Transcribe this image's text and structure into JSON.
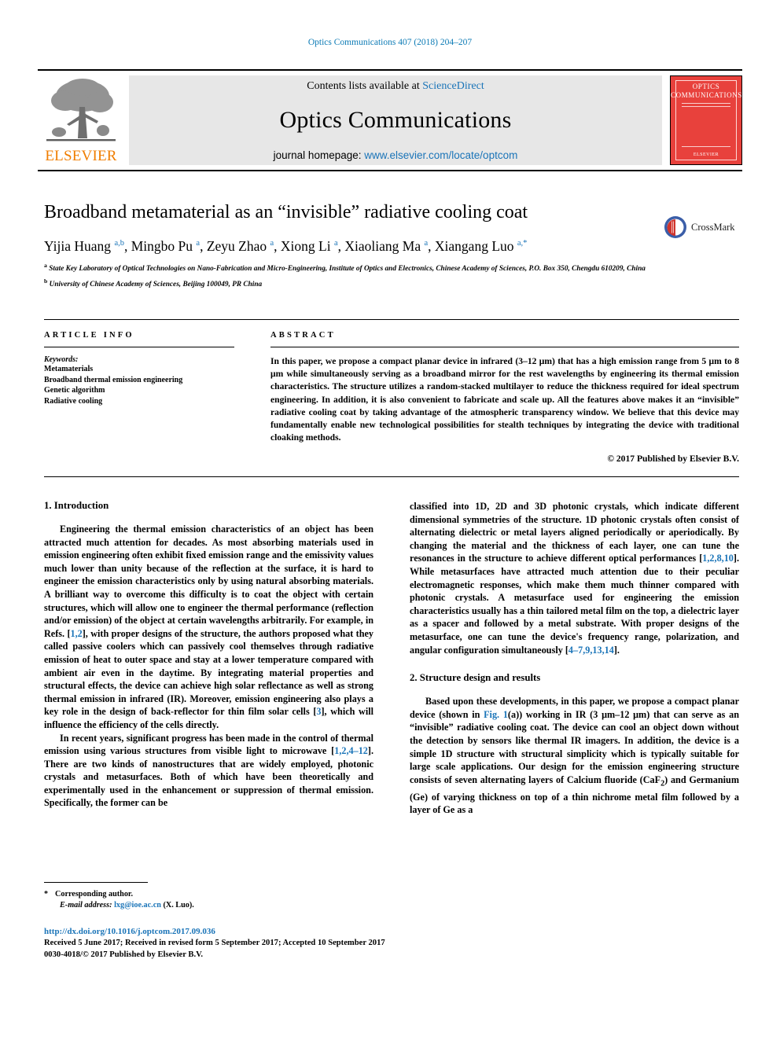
{
  "running_head": "Optics Communications 407 (2018) 204–207",
  "masthead": {
    "contents_prefix": "Contents lists available at ",
    "contents_link": "ScienceDirect",
    "journal_title": "Optics Communications",
    "homepage_prefix": "journal homepage: ",
    "homepage_link": "www.elsevier.com/locate/optcom",
    "publisher_wordmark": "ELSEVIER",
    "cover_line1": "OPTICS",
    "cover_line2": "COMMUNICATIONS",
    "cover_bottom": "ELSEVIER"
  },
  "article": {
    "title": "Broadband metamaterial as an “invisible” radiative cooling coat",
    "authors_html": "Yijia Huang <sup>a,b</sup>, Mingbo Pu <sup>a</sup>, Zeyu Zhao <sup>a</sup>, Xiong Li <sup>a</sup>, Xiaoliang Ma <sup>a</sup>, Xiangang Luo <sup>a,*</sup>",
    "affiliation_a": "State Key Laboratory of Optical Technologies on Nano-Fabrication and Micro-Engineering, Institute of Optics and Electronics, Chinese Academy of Sciences, P.O. Box 350, Chengdu 610209, China",
    "affiliation_b": "University of Chinese Academy of Sciences, Beijing 100049, PR China",
    "crossmark_label": "CrossMark"
  },
  "info": {
    "heading": "ARTICLE INFO",
    "keywords_label": "Keywords:",
    "keywords": [
      "Metamaterials",
      "Broadband thermal emission engineering",
      "Genetic algorithm",
      "Radiative cooling"
    ]
  },
  "abstract": {
    "heading": "ABSTRACT",
    "text": "In this paper, we propose a compact planar device in infrared (3–12 μm) that has a high emission range from 5 μm to 8 μm while simultaneously serving as a broadband mirror for the rest wavelengths by engineering its thermal emission characteristics. The structure utilizes a random-stacked multilayer to reduce the thickness required for ideal spectrum engineering. In addition, it is also convenient to fabricate and scale up. All the features above makes it an “invisible” radiative cooling coat by taking advantage of the atmospheric transparency window. We believe that this device may fundamentally enable new technological possibilities for stealth techniques by integrating the device with traditional cloaking methods.",
    "copyright": "© 2017 Published by Elsevier B.V."
  },
  "body": {
    "section1_title": "1.  Introduction",
    "section2_title": "2.  Structure design and results",
    "p1_a": "Engineering the thermal emission characteristics of an object has been attracted much attention for decades. As most absorbing materials used in emission engineering often exhibit fixed emission range and the emissivity values much lower than unity because of the reflection at the surface, it is hard to engineer the emission characteristics only by using natural absorbing materials. A brilliant way to overcome this difficulty is to coat the object with certain structures, which will allow one to engineer the thermal performance (reflection and/or emission) of the object at certain wavelengths arbitrarily. For example, in Refs. [",
    "p1_ref": "1,2",
    "p1_b": "], with proper designs of the structure, the authors proposed what they called passive coolers which can passively cool themselves through radiative emission of heat to outer space and stay at a lower temperature compared with ambient air even in the daytime. By integrating material properties and structural effects, the device can achieve high solar reflectance as well as strong thermal emission in infrared (IR). Moreover, emission engineering also plays a key role in the design of back-reflector for thin film solar cells [",
    "p1_ref2": "3",
    "p1_c": "], which will influence the efficiency of the cells directly.",
    "p2_a": "In recent years, significant progress has been made in the control of thermal emission using various structures from visible light to microwave [",
    "p2_ref": "1,2,4–12",
    "p2_b": "]. There are two kinds of nanostructures that are widely employed, photonic crystals and metasurfaces. Both of which have been theoretically and experimentally used in the enhancement or suppression of thermal emission. Specifically, the former can be",
    "p3_a": "classified into 1D, 2D and 3D photonic crystals, which indicate different dimensional symmetries of the structure. 1D photonic crystals often consist of alternating dielectric or metal layers aligned periodically or aperiodically. By changing the material and the thickness of each layer, one can tune the resonances in the structure to achieve different optical performances [",
    "p3_ref": "1,2,8,10",
    "p3_b": "]. While metasurfaces have attracted much attention due to their peculiar electromagnetic responses, which make them much thinner compared with photonic crystals. A metasurface used for engineering the emission characteristics usually has a thin tailored metal film on the top, a dielectric layer as a spacer and followed by a metal substrate. With proper designs of the metasurface, one can tune the device's frequency range, polarization, and angular configuration simultaneously [",
    "p3_ref2": "4–7,9,13,14",
    "p3_c": "].",
    "p4_a": "Based upon these developments, in this paper, we propose a compact planar device (shown in ",
    "p4_figref": "Fig. 1",
    "p4_b": "(a)) working in IR (3 μm–12 μm) that can serve as an “invisible” radiative cooling coat. The device can cool an object down without the detection by sensors like thermal IR imagers. In addition, the device is a simple 1D structure with structural simplicity which is typically suitable for large scale applications. Our design for the emission engineering structure consists of seven alternating layers of Calcium fluoride (CaF",
    "p4_sub": "2",
    "p4_c": ") and Germanium (Ge) of varying thickness on top of a thin nichrome metal film followed by a layer of Ge as a"
  },
  "footer": {
    "corresponding_star": "*",
    "corresponding_text": "Corresponding author.",
    "email_label": "E-mail address:",
    "email": "lxg@ioe.ac.cn",
    "email_suffix": "(X. Luo).",
    "doi": "http://dx.doi.org/10.1016/j.optcom.2017.09.036",
    "history": "Received 5 June 2017; Received in revised form 5 September 2017; Accepted 10 September 2017",
    "issn": "0030-4018/© 2017 Published by Elsevier B.V."
  },
  "colors": {
    "link": "#1a74b8",
    "running_head": "#0b7ab5",
    "elsevier_orange": "#f07d00",
    "cover_red": "#e8413c"
  }
}
